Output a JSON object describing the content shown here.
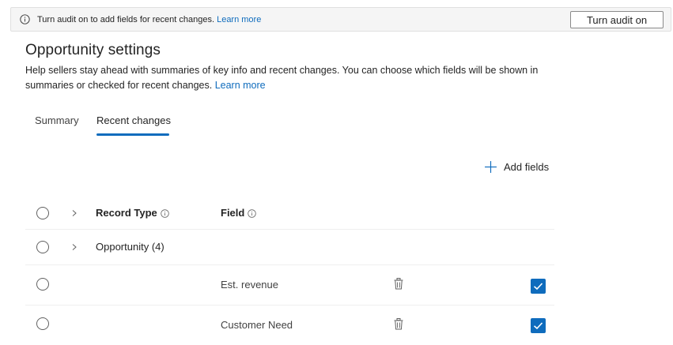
{
  "banner": {
    "icon": "info-icon",
    "message": "Turn audit on to add fields for recent changes.",
    "link": "Learn more",
    "button": "Turn audit on"
  },
  "page": {
    "title": "Opportunity settings",
    "description": "Help sellers stay ahead with summaries of key info and recent changes. You can choose which fields will be shown in summaries or checked for recent changes.",
    "learn_more": "Learn more"
  },
  "tabs": [
    {
      "label": "Summary",
      "selected": false
    },
    {
      "label": "Recent changes",
      "selected": true
    }
  ],
  "toolbar": {
    "add_fields_icon": "plus-icon",
    "add_fields": "Add fields"
  },
  "table": {
    "columns": {
      "record_type": "Record Type",
      "field": "Field"
    },
    "group": {
      "label": "Opportunity (4)",
      "expanded": true
    },
    "rows": [
      {
        "field": "Est. revenue",
        "checked": true
      },
      {
        "field": "Customer Need",
        "checked": true
      }
    ]
  },
  "colors": {
    "accent": "#0f6cbd",
    "banner_bg": "#f5f5f5",
    "text": "#242424",
    "divider": "#efefef"
  }
}
